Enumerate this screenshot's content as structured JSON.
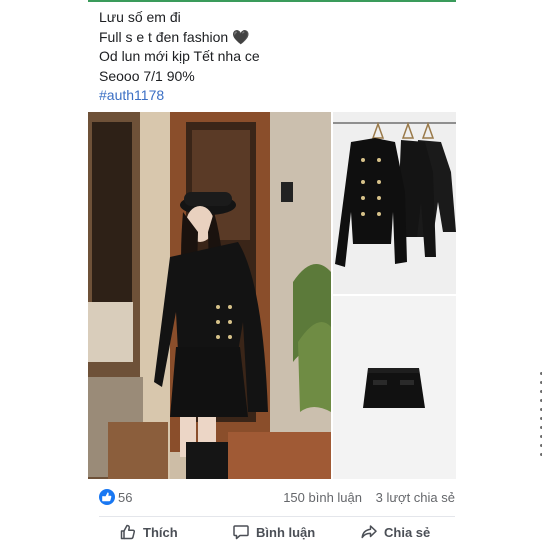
{
  "post": {
    "lines": [
      "Lưu số em đi",
      "Full s e t đen fashion 🖤",
      "Od lun mới kịp Tết nha ce",
      "Seooo 7/1 90%"
    ],
    "hashtag": "#auth1178"
  },
  "media": {
    "main_photo": "woman-black-suit-photo",
    "top_right_photo": "black-jackets-on-hangers-photo",
    "bottom_right_photo": "black-mini-skirt-photo"
  },
  "stats": {
    "likes": "56",
    "comments": "150 bình luận",
    "shares": "3 lượt chia sẻ"
  },
  "actions": {
    "like_label": "Thích",
    "comment_label": "Bình luận",
    "share_label": "Chia sẻ"
  },
  "colors": {
    "accent": "#1877f2",
    "hashtag": "#3b6fc4",
    "top_line": "#3a9b5b"
  },
  "icons": [
    "thumbs-up-icon",
    "like-outline-icon",
    "comment-icon",
    "share-icon"
  ]
}
